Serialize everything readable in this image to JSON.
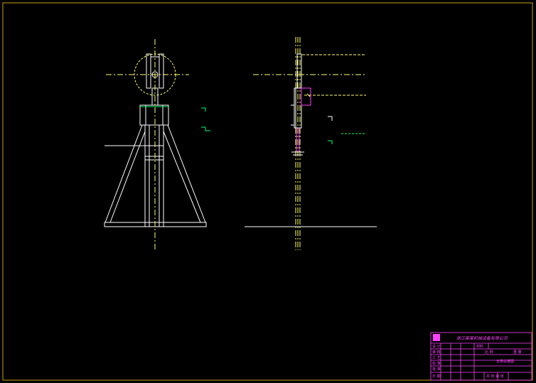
{
  "drawing": {
    "background": "#000000",
    "colors": {
      "frame": "#c8a000",
      "outline": "#ffffff",
      "centerline": "#ffff66",
      "dimension": "#00ff66",
      "title_block": "#ff40ff",
      "highlight": "#ff40ff"
    }
  },
  "title_block": {
    "company": "浙江某某机械设备有限公司",
    "rows": [
      "设 计",
      "审 核",
      "工 艺",
      "标 准",
      "批 准",
      "日 期"
    ],
    "drawing_name": "支架总装图",
    "scale_label": "比 例",
    "sheet_label": "共 张  第 张",
    "material_label": "材料",
    "weight_label": "重 量"
  }
}
